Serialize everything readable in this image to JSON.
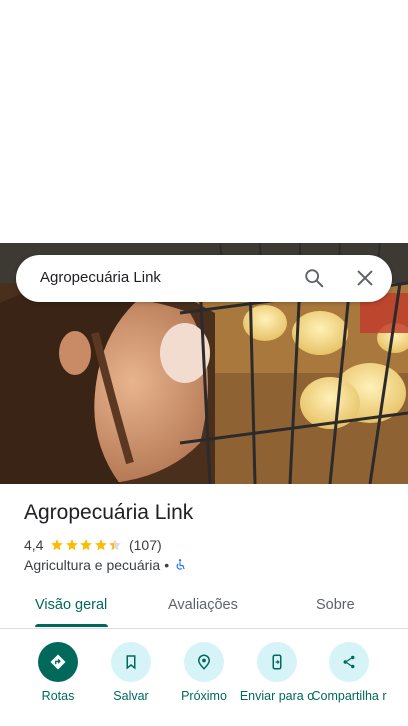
{
  "search": {
    "query": "Agropecuária Link"
  },
  "place": {
    "name": "Agropecuária Link",
    "rating": "4,4",
    "stars_value": 4.4,
    "review_count": "(107)",
    "category": "Agricultura e pecuária",
    "separator": "•"
  },
  "tabs": [
    {
      "label": "Visão geral",
      "active": true
    },
    {
      "label": "Avaliações",
      "active": false
    },
    {
      "label": "Sobre",
      "active": false
    }
  ],
  "actions": [
    {
      "label": "Rotas",
      "icon": "directions-icon"
    },
    {
      "label": "Salvar",
      "icon": "bookmark-icon"
    },
    {
      "label": "Próximo",
      "icon": "nearby-icon"
    },
    {
      "label": "Enviar para o",
      "icon": "send-to-phone-icon"
    },
    {
      "label": "Compartilha r",
      "icon": "share-icon"
    }
  ],
  "colors": {
    "accent": "#00695c",
    "star": "#fbbc04",
    "chip": "#d6f4f8"
  }
}
